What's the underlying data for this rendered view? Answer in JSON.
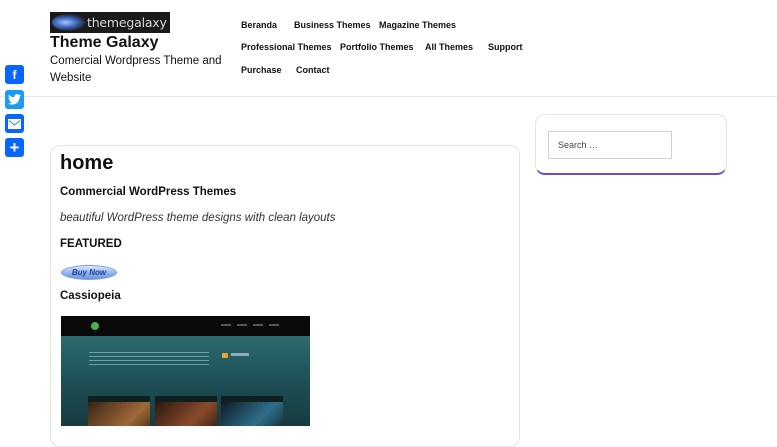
{
  "header": {
    "logo_text": "themegalaxy",
    "site_title": "Theme Galaxy",
    "site_description": "Comercial Wordpress Theme and Website"
  },
  "nav": {
    "items": [
      {
        "label": "Beranda"
      },
      {
        "label": "Business Themes"
      },
      {
        "label": "Magazine Themes"
      },
      {
        "label": "Professional Themes"
      },
      {
        "label": "Portfolio Themes"
      },
      {
        "label": "All Themes"
      },
      {
        "label": "Support"
      },
      {
        "label": "Purchase"
      },
      {
        "label": "Contact"
      }
    ]
  },
  "share": {
    "buttons": [
      {
        "icon": "facebook-icon",
        "glyph": "f",
        "color": "#0866ff"
      },
      {
        "icon": "twitter-icon",
        "glyph": "t",
        "color": "#1d9bf0"
      },
      {
        "icon": "email-icon",
        "glyph": "✉",
        "color": "#0866ff"
      },
      {
        "icon": "share-plus-icon",
        "glyph": "+",
        "color": "#0866ff"
      }
    ]
  },
  "content": {
    "page_title": "home",
    "heading": "Commercial WordPress Themes",
    "tagline": "beautiful WordPress theme designs with clean layouts",
    "featured_label": "FEATURED",
    "buy_button": "Buy Now",
    "theme_name": "Cassiopeia"
  },
  "sidebar": {
    "search_placeholder": "Search …",
    "accent_color": "#6a4be0"
  }
}
